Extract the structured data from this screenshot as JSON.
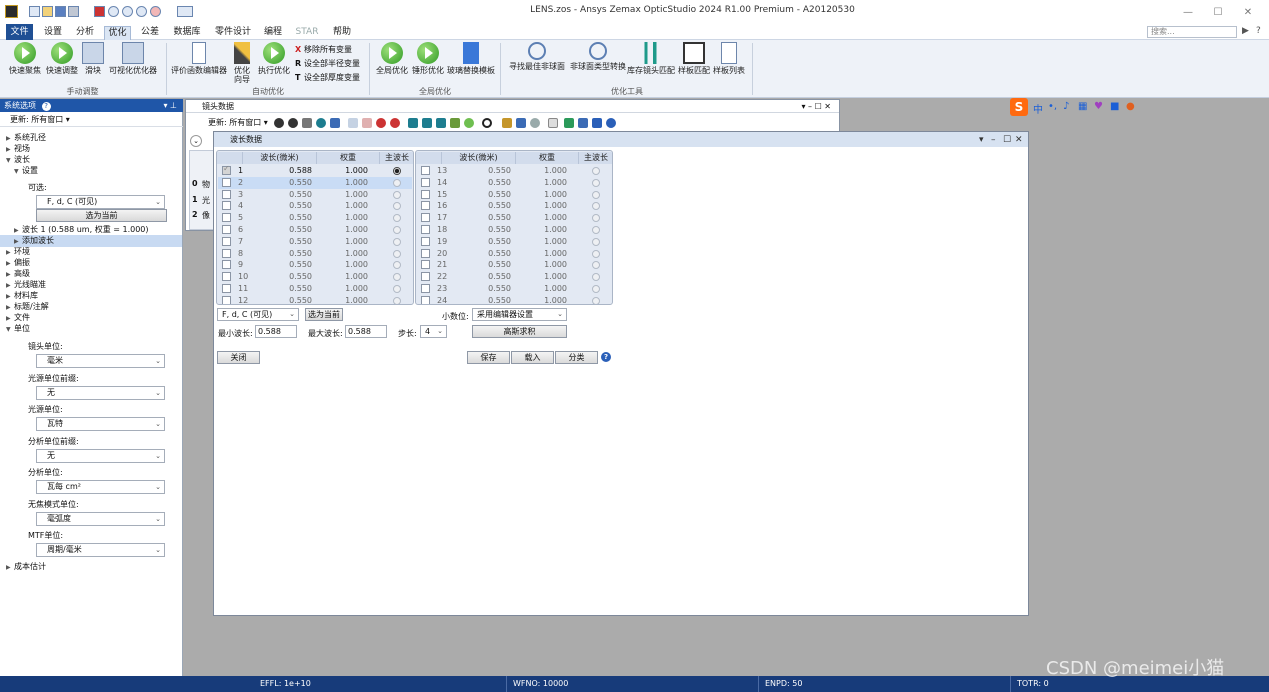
{
  "app": {
    "title": "LENS.zos - Ansys Zemax OpticStudio 2024 R1.00   Premium - A20120530",
    "search_placeholder": "搜索..."
  },
  "menu": {
    "tabs": [
      "文件",
      "设置",
      "分析",
      "优化",
      "公差",
      "数据库",
      "零件设计",
      "编程",
      "STAR",
      "帮助"
    ],
    "active": "优化"
  },
  "ribbon": {
    "manual": {
      "label": "手动调整",
      "buttons": [
        "快速聚焦",
        "快速调整",
        "滑块",
        "可视化优化器"
      ]
    },
    "auto": {
      "label": "自动优化",
      "buttons": [
        "评价函数编辑器",
        "优化\n向导",
        "执行优化"
      ],
      "small": [
        "移除所有变量",
        "设全部半径变量",
        "设全部厚度变量"
      ],
      "small_icons": [
        "X",
        "R",
        "T"
      ]
    },
    "global": {
      "label": "全局优化",
      "buttons": [
        "全局优化",
        "锤形优化",
        "玻璃替换模板"
      ]
    },
    "tools": {
      "label": "优化工具",
      "buttons": [
        "寻找最佳非球面",
        "非球面类型转换",
        "库存镜头匹配",
        "样板匹配",
        "样板列表"
      ]
    }
  },
  "left_panel": {
    "title": "系统选项",
    "update": "更新: 所有窗口 ▾",
    "tree": [
      "系统孔径",
      "视场",
      "波长",
      "设置",
      "可选:",
      "波长 1 (0.588 um, 权重 = 1.000)",
      "添加波长",
      "环境",
      "偏振",
      "高级",
      "光线瞄准",
      "材料库",
      "标题/注解",
      "文件",
      "单位",
      "成本估计"
    ],
    "wave_preset": "F, d, C (可见)",
    "select_btn": "选为当前",
    "units": [
      {
        "label": "镜头单位:",
        "value": "毫米"
      },
      {
        "label": "光源单位前缀:",
        "value": "无"
      },
      {
        "label": "光源单位:",
        "value": "瓦特"
      },
      {
        "label": "分析单位前缀:",
        "value": "无"
      },
      {
        "label": "分析单位:",
        "value": "瓦每 cm²"
      },
      {
        "label": "无焦模式单位:",
        "value": "毫弧度"
      },
      {
        "label": "MTF单位:",
        "value": "周期/毫米"
      }
    ]
  },
  "lens_data": {
    "title": "镜头数据",
    "update": "更新: 所有窗口 ▾",
    "rows": [
      "0",
      "物",
      "1",
      "光",
      "2",
      "像"
    ]
  },
  "wave_dialog": {
    "title": "波长数据",
    "headers": [
      "波长(微米)",
      "权重",
      "主波长"
    ],
    "rows": [
      {
        "n": "1",
        "wl": "0.588",
        "wt": "1.000",
        "checked": true,
        "primary": true
      },
      {
        "n": "2",
        "wl": "0.550",
        "wt": "1.000"
      },
      {
        "n": "3",
        "wl": "0.550",
        "wt": "1.000"
      },
      {
        "n": "4",
        "wl": "0.550",
        "wt": "1.000"
      },
      {
        "n": "5",
        "wl": "0.550",
        "wt": "1.000"
      },
      {
        "n": "6",
        "wl": "0.550",
        "wt": "1.000"
      },
      {
        "n": "7",
        "wl": "0.550",
        "wt": "1.000"
      },
      {
        "n": "8",
        "wl": "0.550",
        "wt": "1.000"
      },
      {
        "n": "9",
        "wl": "0.550",
        "wt": "1.000"
      },
      {
        "n": "10",
        "wl": "0.550",
        "wt": "1.000"
      },
      {
        "n": "11",
        "wl": "0.550",
        "wt": "1.000"
      },
      {
        "n": "12",
        "wl": "0.550",
        "wt": "1.000"
      },
      {
        "n": "13",
        "wl": "0.550",
        "wt": "1.000"
      },
      {
        "n": "14",
        "wl": "0.550",
        "wt": "1.000"
      },
      {
        "n": "15",
        "wl": "0.550",
        "wt": "1.000"
      },
      {
        "n": "16",
        "wl": "0.550",
        "wt": "1.000"
      },
      {
        "n": "17",
        "wl": "0.550",
        "wt": "1.000"
      },
      {
        "n": "18",
        "wl": "0.550",
        "wt": "1.000"
      },
      {
        "n": "19",
        "wl": "0.550",
        "wt": "1.000"
      },
      {
        "n": "20",
        "wl": "0.550",
        "wt": "1.000"
      },
      {
        "n": "21",
        "wl": "0.550",
        "wt": "1.000"
      },
      {
        "n": "22",
        "wl": "0.550",
        "wt": "1.000"
      },
      {
        "n": "23",
        "wl": "0.550",
        "wt": "1.000"
      },
      {
        "n": "24",
        "wl": "0.550",
        "wt": "1.000"
      }
    ],
    "preset": "F, d, C (可见)",
    "select_current": "选为当前",
    "decimals_label": "小数位:",
    "decimals_value": "采用编辑器设置",
    "gauss": "高斯求积",
    "min_label": "最小波长:",
    "min_value": "0.588",
    "max_label": "最大波长:",
    "max_value": "0.588",
    "step_label": "步长:",
    "step_value": "4",
    "close": "关闭",
    "save": "保存",
    "load": "载入",
    "sort": "分类"
  },
  "status": {
    "effl": "EFFL: 1e+10",
    "wfno": "WFNO: 10000",
    "enpd": "ENPD: 50",
    "totr": "TOTR: 0"
  },
  "watermark": "CSDN @meimei小猫"
}
